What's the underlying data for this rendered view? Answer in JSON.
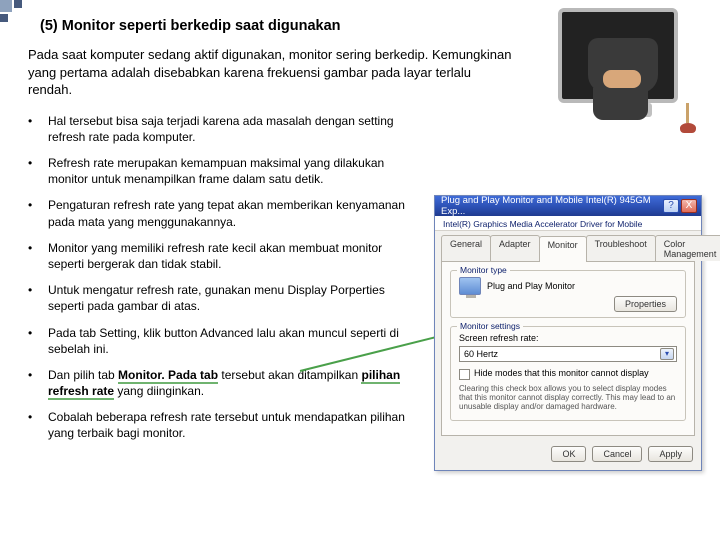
{
  "title": "(5) Monitor seperti berkedip saat digunakan",
  "intro": "Pada saat komputer sedang aktif digunakan, monitor sering berkedip. Kemungkinan yang pertama adalah disebabkan karena frekuensi gambar pada layar terlalu rendah.",
  "bullets": [
    "Hal tersebut bisa saja terjadi karena ada masalah dengan setting refresh rate pada komputer.",
    "Refresh rate merupakan kemampuan maksimal yang dilakukan monitor untuk menampilkan frame dalam satu detik.",
    "Pengaturan refresh rate yang tepat akan memberikan kenyamanan pada mata yang menggunakannya.",
    "Monitor yang memiliki refresh rate kecil akan membuat monitor seperti bergerak dan tidak stabil.",
    "Untuk mengatur refresh rate, gunakan menu Display Porperties seperti pada gambar di atas.",
    "Pada tab Setting, klik  button Advanced lalu akan muncul seperti di sebelah ini.",
    "",
    "Cobalah beberapa refresh rate tersebut untuk mendapatkan pilihan yang terbaik bagi monitor."
  ],
  "bullet7_pre": "Dan pilih tab ",
  "bullet7_b1": "Monitor. Pada tab",
  "bullet7_mid": " tersebut akan ditampilkan ",
  "bullet7_b2": "pilihan refresh rate",
  "bullet7_post": " yang diinginkan.",
  "dialog": {
    "title": "Plug and Play Monitor and Mobile Intel(R) 945GM Exp...",
    "help": "?",
    "close": "X",
    "subtitle": "Intel(R) Graphics Media Accelerator Driver for Mobile",
    "tabs": {
      "general": "General",
      "adapter": "Adapter",
      "monitor": "Monitor",
      "troubleshoot": "Troubleshoot",
      "color": "Color Management"
    },
    "grp_monitor_type": "Monitor type",
    "monitor_name": "Plug and Play Monitor",
    "properties_btn": "Properties",
    "grp_monitor_settings": "Monitor settings",
    "label_refresh": "Screen refresh rate:",
    "refresh_value": "60 Hertz",
    "hide_modes": "Hide modes that this monitor cannot display",
    "hide_note": "Clearing this check box allows you to select display modes that this monitor cannot display correctly. This may lead to an unusable display and/or damaged hardware.",
    "ok": "OK",
    "cancel": "Cancel",
    "apply": "Apply"
  }
}
